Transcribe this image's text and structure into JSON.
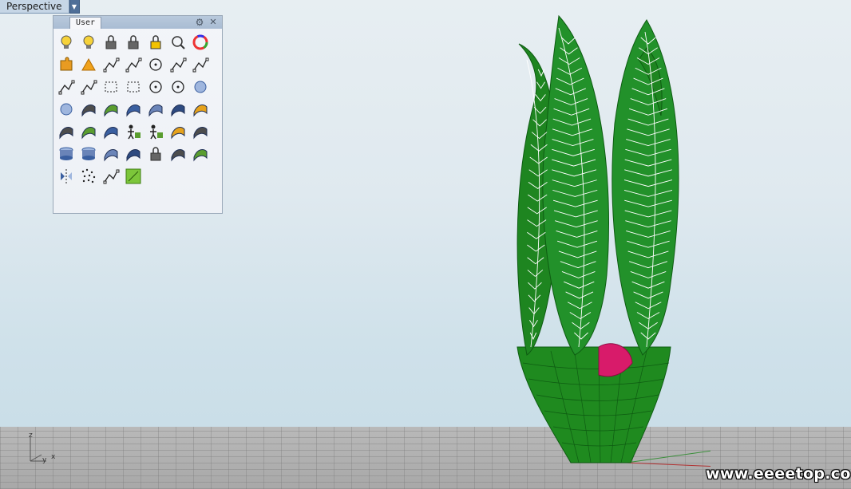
{
  "viewport": {
    "title": "Perspective",
    "dropdown_icon": "triangle-down-icon"
  },
  "toolbar_panel": {
    "tab_label": "User",
    "gear_icon": "gear-icon",
    "close_icon": "close-icon",
    "buttons": [
      "light-bulb-off-icon",
      "light-bulb-on-icon",
      "lock-icon",
      "unlock-icon",
      "unlock-selected-icon",
      "zoom-extents-icon",
      "color-wheel-icon",
      "puzzle-icon",
      "explode-icon",
      "line-icon",
      "polyline-icon",
      "circle-point-icon",
      "curve-points-icon",
      "fillet-curve-icon",
      "degree-curve-icon",
      "zigzag-curve-icon",
      "rectangle-select-icon",
      "rectangle-icon",
      "circle-center-icon",
      "ellipse-icon",
      "sphere-icon",
      "sphere-dots-icon",
      "surface-diamond-icon",
      "sweep-1-icon",
      "sweep-2-icon",
      "blend-surface-icon",
      "fillet-surface-icon",
      "offset-surface-icon",
      "revolve-1-icon",
      "revolve-2-icon",
      "extrude-icon",
      "dimension-person-icon",
      "dimension-person-2-icon",
      "twist-surface-icon",
      "plane-surface-icon",
      "cylinder-1-icon",
      "cylinder-2-icon",
      "unroll-surface-icon",
      "layer-stack-icon",
      "group-blocks-icon",
      "scale-arrow-icon",
      "split-edge-icon",
      "mirror-icon",
      "point-cloud-icon",
      "arc-icon",
      "texture-map-icon"
    ]
  },
  "axis": {
    "z_label": "z",
    "y_label": "y",
    "x_label": "x"
  },
  "watermark": "www.eeeetop.com",
  "colors": {
    "leaf_green": "#1f8a1f",
    "leaf_dark": "#0e5c12",
    "wire_white": "#ffffff",
    "flower_pink": "#d81b6a",
    "panel_title": "#b0c2d8"
  }
}
